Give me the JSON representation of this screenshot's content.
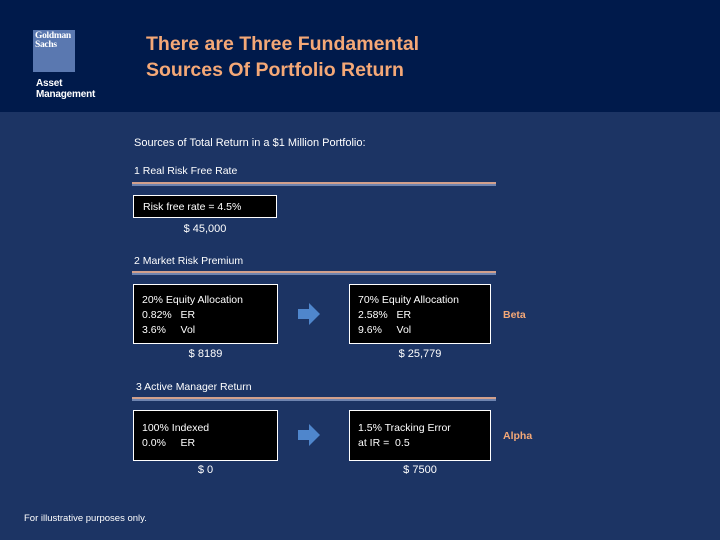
{
  "header": {
    "logo": {
      "line1": "Goldman",
      "line2": "Sachs",
      "sub1": "Asset",
      "sub2": "Management"
    },
    "title_line1": "There are Three Fundamental",
    "title_line2": "Sources Of Portfolio Return"
  },
  "intro": "Sources of Total Return in a $1 Million Portfolio:",
  "sections": [
    {
      "label": "1  Real Risk Free Rate",
      "box": {
        "lines": [
          "Risk free rate = 4.5%"
        ]
      },
      "amount": "$ 45,000"
    },
    {
      "label": "2  Market Risk Premium",
      "left_box": {
        "lines": [
          "20% Equity Allocation",
          "0.82%   ER",
          "3.6%     Vol"
        ]
      },
      "left_amount": "$ 8189",
      "right_box": {
        "lines": [
          "70% Equity Allocation",
          "2.58%   ER",
          "9.6%     Vol"
        ]
      },
      "right_amount": "$ 25,779",
      "side_label": "Beta"
    },
    {
      "label": "3  Active Manager Return",
      "left_box": {
        "lines": [
          "100% Indexed",
          "0.0%     ER"
        ]
      },
      "left_amount": "$ 0",
      "right_box": {
        "lines": [
          "1.5% Tracking Error",
          "at IR =  0.5"
        ]
      },
      "right_amount": "$ 7500",
      "side_label": "Alpha"
    }
  ],
  "footnote": "For illustrative purposes only.",
  "colors": {
    "header_bg": "#001a4b",
    "body_bg": "#1c3464",
    "accent": "#f4a877",
    "arrow": "#4f86cc",
    "logo": "#5a78b0"
  }
}
